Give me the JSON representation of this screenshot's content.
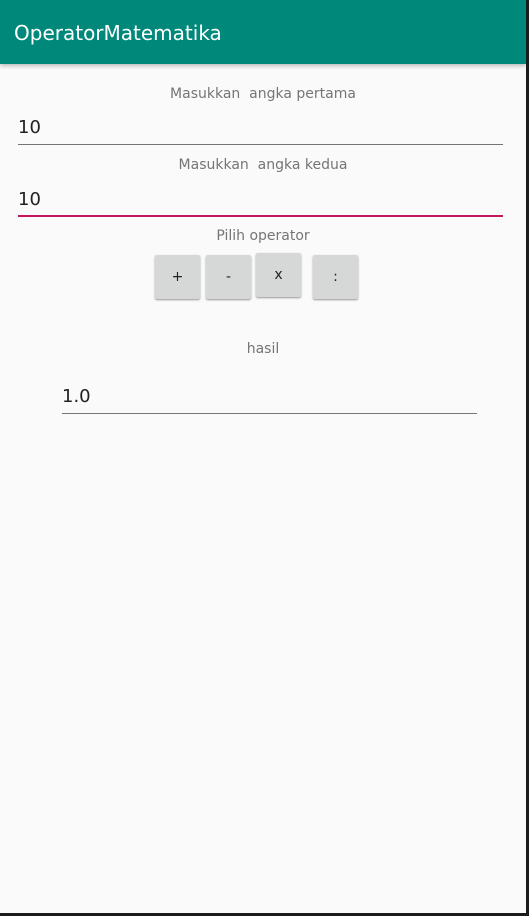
{
  "app_bar": {
    "title": "OperatorMatematika",
    "color": "#00897b"
  },
  "form": {
    "first_number": {
      "label": "Masukkan  angka pertama",
      "value": "10"
    },
    "second_number": {
      "label": "Masukkan  angka kedua",
      "value": "10",
      "focused": true,
      "accent_color": "#c2185b"
    },
    "operator_label": "Pilih operator",
    "operators": [
      "+",
      "-",
      "x",
      ":"
    ]
  },
  "result": {
    "label": "hasil",
    "value": "1.0"
  }
}
